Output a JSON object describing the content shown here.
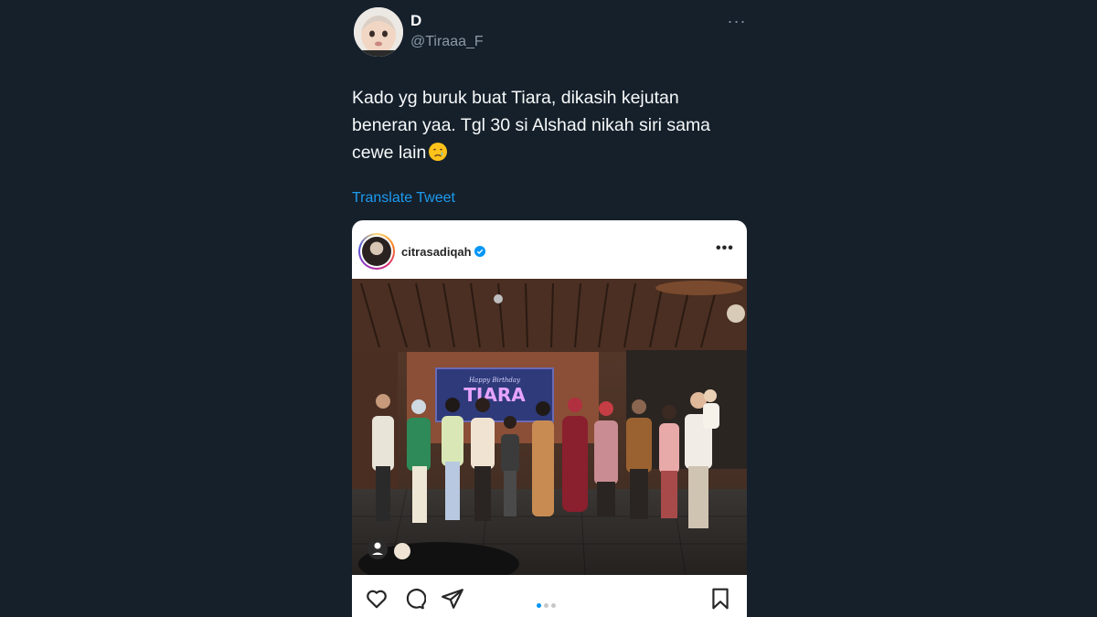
{
  "tweet": {
    "display_name": "D",
    "handle": "@Tiraaa_F",
    "more_icon": "more-horizontal-icon",
    "text": "Kado yg buruk buat Tiara, dikasih kejutan beneran yaa. Tgl 30 si Alshad nikah siri sama cewe lain",
    "emoji": "crying-face-emoji",
    "translate_label": "Translate Tweet"
  },
  "embed": {
    "username": "citrasadiqah",
    "verified_icon": "verified-badge-icon",
    "more_icon": "more-horizontal-icon",
    "photo_banner_script": "Happy Birthday",
    "photo_banner_name": "TIARA",
    "carousel": {
      "total": 3,
      "active": 1
    },
    "actions": [
      "heart-icon",
      "comment-icon",
      "share-icon",
      "bookmark-icon"
    ]
  },
  "colors": {
    "background": "#15202b",
    "link": "#1d9bf0",
    "muted": "#8b98a5",
    "ig_active_dot": "#0095f6"
  }
}
